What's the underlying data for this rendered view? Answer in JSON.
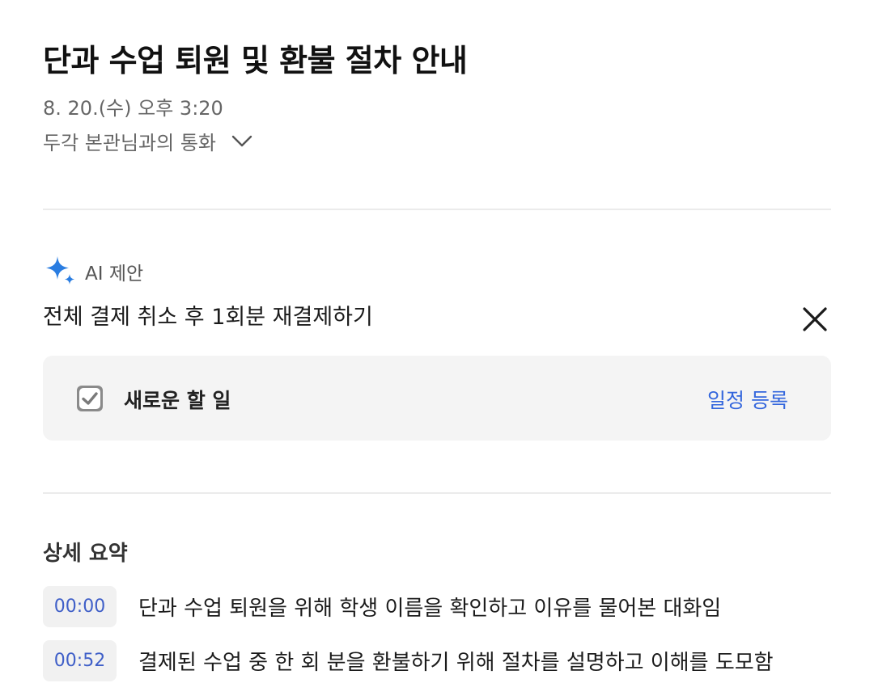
{
  "title": "단과 수업 퇴원 및 환불 절차 안내",
  "date_time": "8. 20.(수) 오후 3:20",
  "call_info": "두각 본관님과의 통화",
  "ai": {
    "label": "AI 제안",
    "suggestion": "전체 결제 취소 후 1회분 재결제하기",
    "icon": "sparkle-icon",
    "accent_color": "#2a7de1"
  },
  "task": {
    "checked": true,
    "label": "새로운 할 일",
    "action": "일정 등록",
    "action_color": "#3366dd"
  },
  "summary": {
    "title": "상세 요약",
    "items": [
      {
        "time": "00:00",
        "text": "단과 수업 퇴원을 위해 학생 이름을 확인하고 이유를 물어본 대화임"
      },
      {
        "time": "00:52",
        "text": "결제된 수업 중 한 회 분을 환불하기 위해 절차를 설명하고 이해를 도모함"
      }
    ]
  }
}
